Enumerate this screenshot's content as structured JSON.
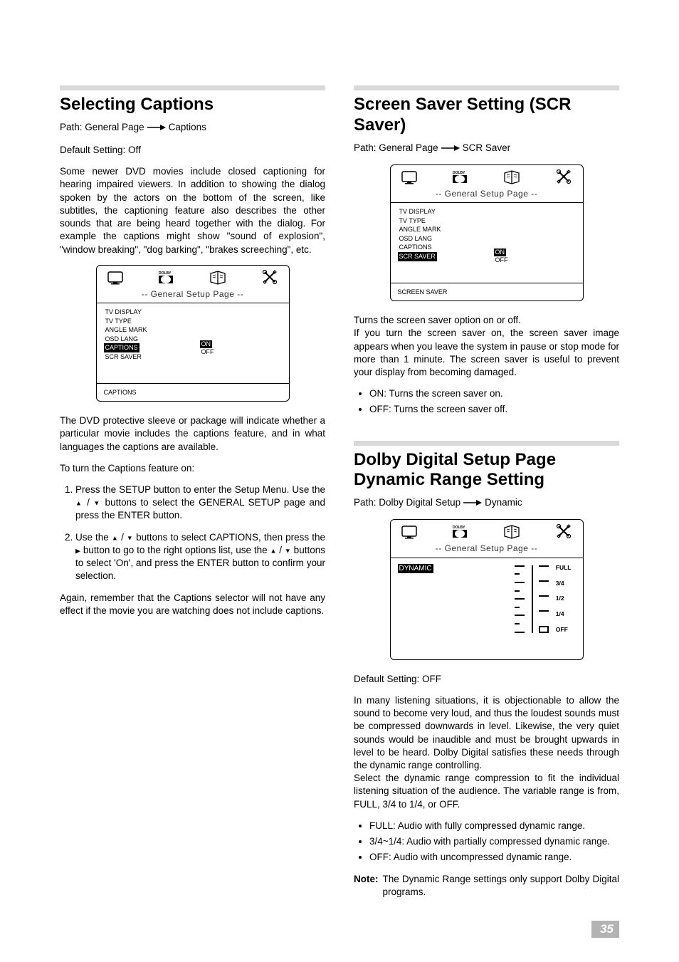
{
  "pageNumber": "35",
  "left": {
    "captions": {
      "title": "Selecting Captions",
      "path_prefix": "Path: General Page",
      "path_suffix": "Captions",
      "default_setting": "Default Setting: Off",
      "intro": "Some newer DVD movies include closed captioning for hearing impaired viewers. In addition to showing the dialog spoken by the actors on the bottom of the screen, like subtitles, the captioning feature also describes the other sounds that are being heard together with the dialog. For example the captions might show \"sound of explosion\", \"window breaking\", \"dog barking\", \"brakes screeching\", etc.",
      "setup_box": {
        "title": "-- General Setup Page --",
        "menu": [
          "TV DISPLAY",
          "TV TYPE",
          "ANGLE MARK",
          "OSD LANG",
          "CAPTIONS",
          "SCR SAVER"
        ],
        "selected": "CAPTIONS",
        "options": [
          "ON",
          "OFF"
        ],
        "opt_selected": "ON",
        "footer": "CAPTIONS"
      },
      "after_box": "The DVD protective sleeve or package will indicate whether a particular movie includes the captions feature, and in what languages the captions are available.",
      "turn_on": "To turn the Captions feature on:",
      "step1a": "Press the SETUP button to enter the Setup Menu. Use the ",
      "step1b": " buttons to select the GENERAL SETUP page and press the ENTER button.",
      "step2a": "Use the ",
      "step2b": " buttons to select CAPTIONS, then press the ",
      "step2c": " button to go to the right options list, use the ",
      "step2d": " buttons to select 'On', and press the ENTER button to confirm your selection.",
      "closing": "Again, remember that the Captions selector will not have any effect if the movie you are watching does not include captions."
    }
  },
  "right": {
    "scr_saver": {
      "title": "Screen Saver Setting (SCR Saver)",
      "path_prefix": "Path: General Page",
      "path_suffix": "SCR Saver",
      "setup_box": {
        "title": "-- General Setup Page --",
        "menu": [
          "TV DISPLAY",
          "TV TYPE",
          "ANGLE MARK",
          "OSD LANG",
          "CAPTIONS",
          "SCR SAVER"
        ],
        "selected": "SCR SAVER",
        "options": [
          "ON",
          "OFF"
        ],
        "opt_selected": "ON",
        "footer": "SCREEN SAVER"
      },
      "body1": "Turns the screen saver option on or off.",
      "body2": "If you turn the screen saver on, the screen saver image appears when you leave the system in pause or stop mode for more than 1 minute. The screen saver is useful to prevent your display from becoming damaged.",
      "bullet1": "ON: Turns the screen saver on.",
      "bullet2": "OFF: Turns the screen saver off."
    },
    "dolby": {
      "title": "Dolby Digital Setup Page Dynamic Range Setting",
      "path_prefix": "Path: Dolby Digital Setup",
      "path_suffix": "Dynamic",
      "setup_box": {
        "title": "-- General Setup Page --",
        "menu_selected": "DYNAMIC",
        "scale": [
          "FULL",
          "3/4",
          "1/2",
          "1/4",
          "OFF"
        ]
      },
      "default_setting": "Default Setting: OFF",
      "body1": "In many listening situations, it is objectionable to allow the sound to become very loud, and thus the loudest sounds must be compressed downwards in level. Likewise, the very quiet sounds would be inaudible and must be brought upwards in level to be heard. Dolby Digital satisfies these needs through the dynamic range controlling.",
      "body2": "Select the dynamic range compression to fit the individual listening situation of the audience. The variable range is from, FULL, 3/4 to 1/4, or OFF.",
      "bullet1": "FULL: Audio with fully compressed dynamic range.",
      "bullet2": "3/4~1/4: Audio with partially compressed dynamic range.",
      "bullet3": "OFF: Audio with uncompressed dynamic range.",
      "note_label": "Note:",
      "note_text": "The Dynamic Range settings only support Dolby Digital programs."
    }
  }
}
